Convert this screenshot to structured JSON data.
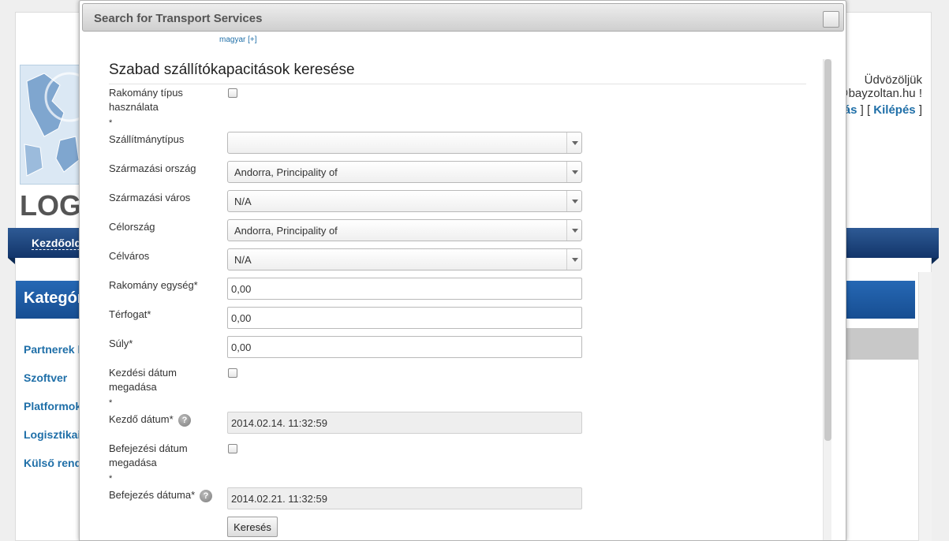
{
  "background": {
    "logo_text": "LOGI",
    "welcome": "Üdvözöljük",
    "user_email_fragment": "s@bayzoltan.hu",
    "user_suffix": "!",
    "links_prefix": "tatás",
    "links_sep": "] [",
    "logout_label": "Kilépés",
    "links_end": "]",
    "nav_home": "Kezdőolda",
    "category_title": "Kategória",
    "category_items": [
      "Partnerek ke",
      "Szoftver",
      "Platformok",
      "Logisztikai d",
      "Külső rendsz"
    ]
  },
  "dialog": {
    "title": "Search for Transport Services",
    "language_link": "magyar [+]",
    "form_title": "Szabad szállítókapacitások keresése",
    "fields": {
      "cargo_type_usage": {
        "label_line1": "Rakomány típus",
        "label_line2": "használata",
        "checked": false
      },
      "required_mark": "*",
      "shipment_type": {
        "label": "Szállítmánytípus",
        "value": ""
      },
      "origin_country": {
        "label": "Származási ország",
        "value": "Andorra, Principality of"
      },
      "origin_city": {
        "label": "Származási város",
        "value": "N/A"
      },
      "destination_country": {
        "label": "Célország",
        "value": "Andorra, Principality of"
      },
      "destination_city": {
        "label": "Célváros",
        "value": "N/A"
      },
      "cargo_unit": {
        "label": "Rakomány egység*",
        "value": "0,00"
      },
      "volume": {
        "label": "Térfogat*",
        "value": "0,00"
      },
      "weight": {
        "label": "Súly*",
        "value": "0,00"
      },
      "start_date_enable": {
        "label_line1": "Kezdési dátum",
        "label_line2": "megadása",
        "checked": false
      },
      "start_date": {
        "label": "Kezdő dátum*",
        "value": "2014.02.14. 11:32:59"
      },
      "end_date_enable": {
        "label_line1": "Befejezési dátum",
        "label_line2": "megadása",
        "checked": false
      },
      "end_date": {
        "label": "Befejezés dátuma*",
        "value": "2014.02.21. 11:32:59"
      }
    },
    "help_glyph": "?",
    "search_button": "Keresés"
  }
}
